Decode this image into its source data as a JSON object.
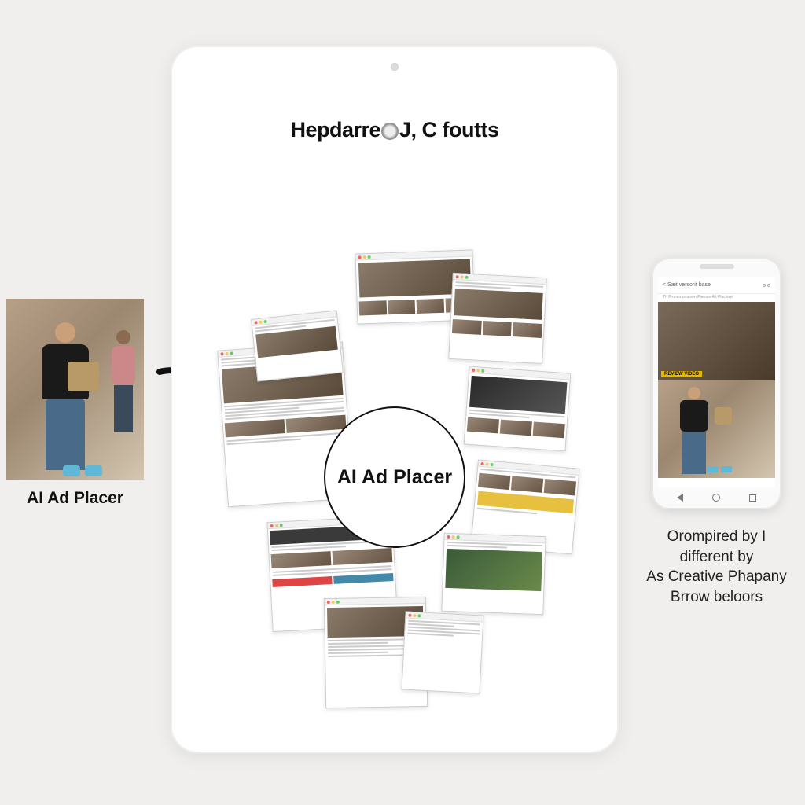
{
  "source": {
    "label": "AI Ad Placer"
  },
  "tablet": {
    "title_part1": "Hepdarre",
    "title_part2": "J, C foutts"
  },
  "center": {
    "label": "AI Ad Placer"
  },
  "phone": {
    "header": "< Sæt versorit base",
    "subheader": "Th Promenomenen Pieroen Att Placteret",
    "banner_tag": "REVIEW VIDEO"
  },
  "phone_caption": {
    "line1": "Orompired by I",
    "line2": "different by",
    "line3": "As Creative Phapany",
    "line4": "Brrow beloors"
  }
}
